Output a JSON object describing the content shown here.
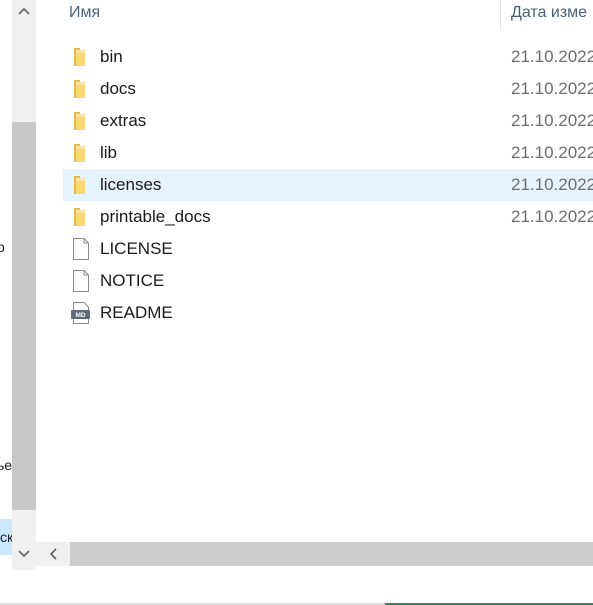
{
  "nav": {
    "frag1": "р",
    "frag2": "ье",
    "frag3": "ск"
  },
  "columns": {
    "name": "Имя",
    "date": "Дата изме"
  },
  "files": [
    {
      "name": "bin",
      "date": "21.10.2022",
      "type": "folder"
    },
    {
      "name": "docs",
      "date": "21.10.2022",
      "type": "folder"
    },
    {
      "name": "extras",
      "date": "21.10.2022",
      "type": "folder"
    },
    {
      "name": "lib",
      "date": "21.10.2022",
      "type": "folder"
    },
    {
      "name": "licenses",
      "date": "21.10.2022",
      "type": "folder"
    },
    {
      "name": "printable_docs",
      "date": "21.10.2022",
      "type": "folder"
    },
    {
      "name": "LICENSE",
      "date": "",
      "type": "file"
    },
    {
      "name": "NOTICE",
      "date": "",
      "type": "file"
    },
    {
      "name": "README",
      "date": "",
      "type": "markdown"
    }
  ],
  "icons": {
    "md_badge": "MD"
  },
  "colors": {
    "folder": "#f8d775",
    "selection": "#e5f3ff",
    "header_text": "#4c607a"
  }
}
